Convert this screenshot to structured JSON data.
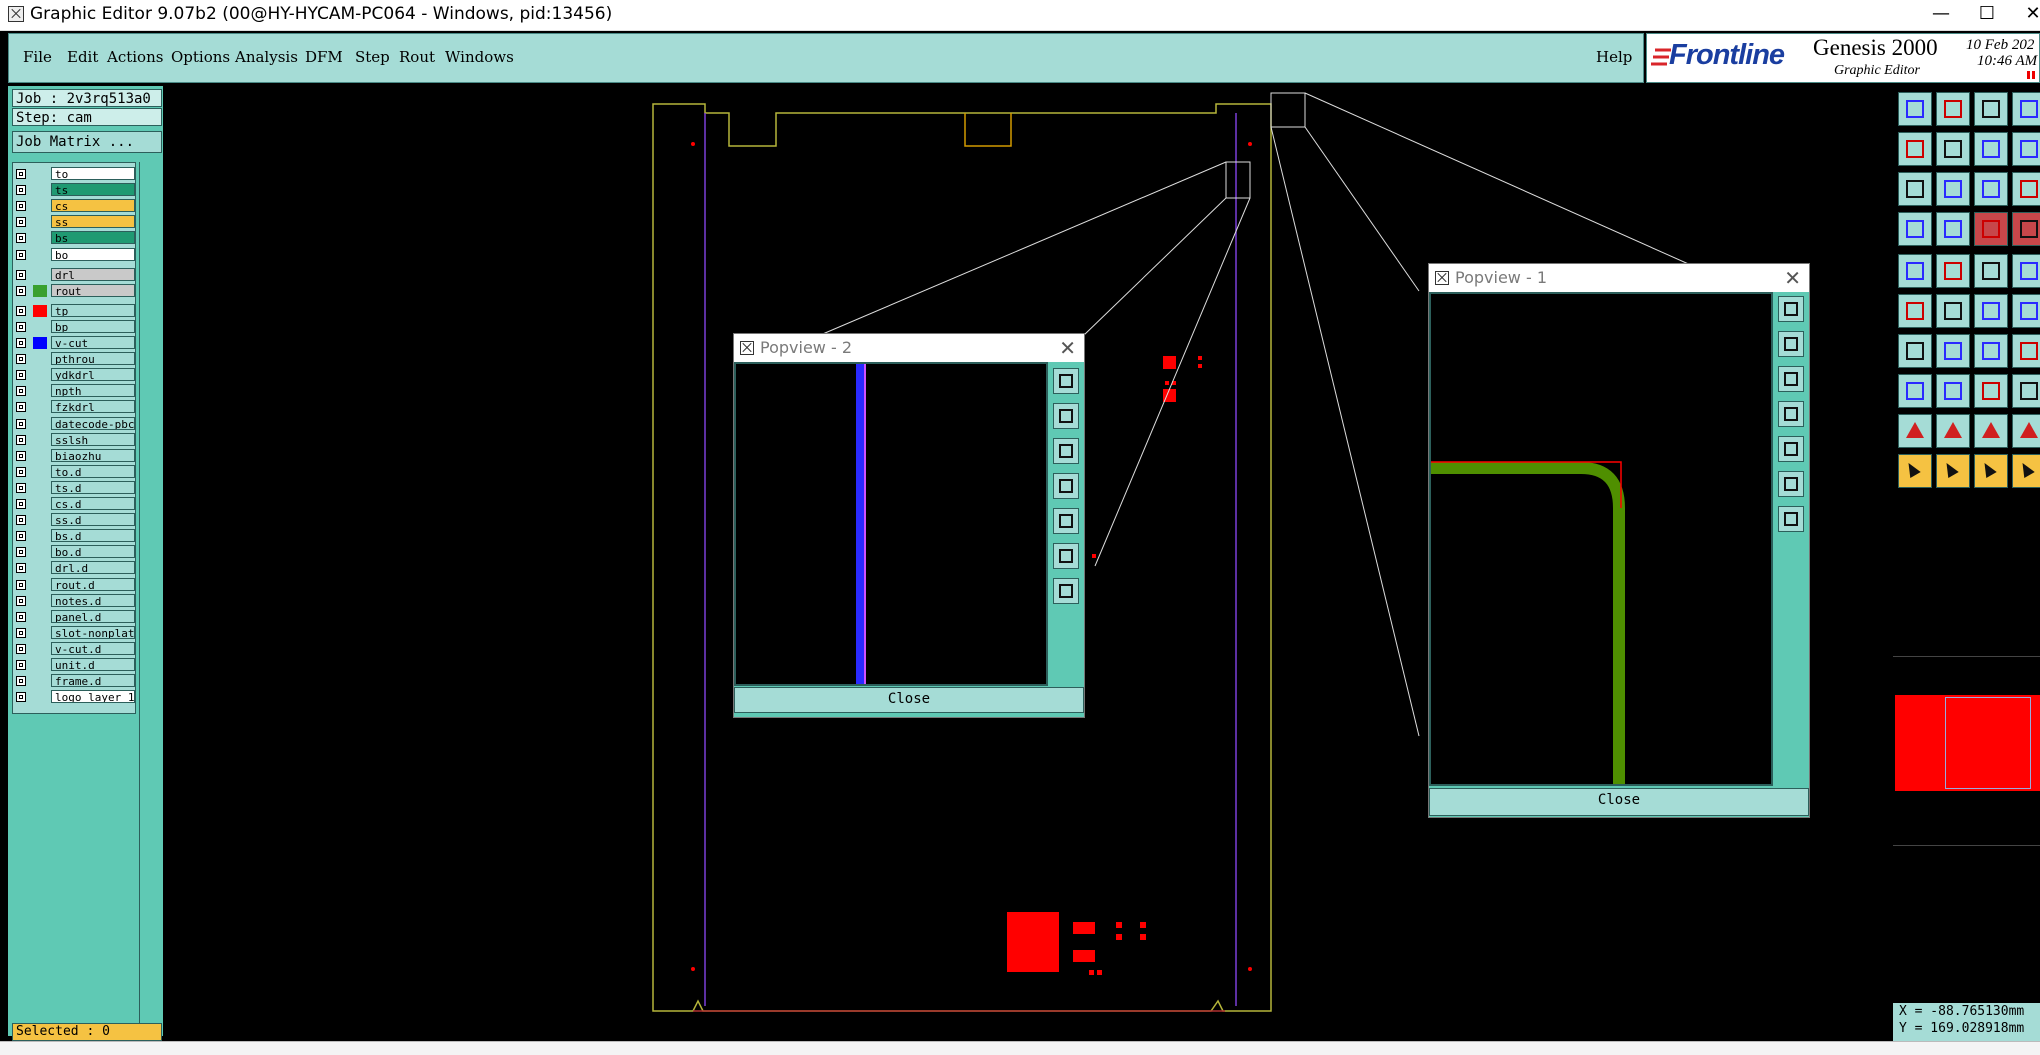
{
  "window": {
    "title": "Graphic Editor 9.07b2 (00@HY-HYCAM-PC064 - Windows, pid:13456)",
    "minimize": "—",
    "maximize": "☐",
    "close": "✕"
  },
  "menu": [
    {
      "label": "File"
    },
    {
      "label": "Edit"
    },
    {
      "label": "Actions"
    },
    {
      "label": "Options"
    },
    {
      "label": "Analysis"
    },
    {
      "label": "DFM"
    },
    {
      "label": "Step"
    },
    {
      "label": "Rout"
    },
    {
      "label": "Windows"
    }
  ],
  "help_label": "Help",
  "brand": {
    "logo": "Frontline",
    "product": "Genesis 2000",
    "subtitle": "Graphic Editor",
    "date": "10 Feb 202",
    "time": "10:46 AM"
  },
  "job": {
    "job_text": "Job : 2v3rq513a0",
    "step_text": "Step: cam",
    "matrix_button": "Job Matrix ..."
  },
  "layers": [
    {
      "name": "to",
      "bg": "#ffffff",
      "swatch": ""
    },
    {
      "name": "ts",
      "bg": "#1f9a72",
      "swatch": ""
    },
    {
      "name": "cs",
      "bg": "#f5c242",
      "swatch": ""
    },
    {
      "name": "ss",
      "bg": "#f5c242",
      "swatch": ""
    },
    {
      "name": "bs",
      "bg": "#1f9a72",
      "swatch": ""
    },
    {
      "name": "bo",
      "bg": "#ffffff",
      "swatch": ""
    },
    {
      "name": "drl",
      "bg": "#c9c9c9",
      "swatch": ""
    },
    {
      "name": "rout",
      "bg": "#c9c9c9",
      "swatch": "#3aa02e"
    },
    {
      "name": "tp",
      "bg": "#a5dcd6",
      "swatch": "#ff0000"
    },
    {
      "name": "bp",
      "bg": "#a5dcd6",
      "swatch": ""
    },
    {
      "name": "v-cut",
      "bg": "#a5dcd6",
      "swatch": "#0000ff"
    },
    {
      "name": "pthrou",
      "bg": "#a5dcd6",
      "swatch": ""
    },
    {
      "name": "ydkdrl",
      "bg": "#a5dcd6",
      "swatch": ""
    },
    {
      "name": "npth",
      "bg": "#a5dcd6",
      "swatch": ""
    },
    {
      "name": "fzkdrl",
      "bg": "#a5dcd6",
      "swatch": ""
    },
    {
      "name": "datecode-pbc",
      "bg": "#a5dcd6",
      "swatch": ""
    },
    {
      "name": "sslsh",
      "bg": "#a5dcd6",
      "swatch": ""
    },
    {
      "name": "biaozhu",
      "bg": "#a5dcd6",
      "swatch": ""
    },
    {
      "name": "to.d",
      "bg": "#a5dcd6",
      "swatch": ""
    },
    {
      "name": "ts.d",
      "bg": "#a5dcd6",
      "swatch": ""
    },
    {
      "name": "cs.d",
      "bg": "#a5dcd6",
      "swatch": ""
    },
    {
      "name": "ss.d",
      "bg": "#a5dcd6",
      "swatch": ""
    },
    {
      "name": "bs.d",
      "bg": "#a5dcd6",
      "swatch": ""
    },
    {
      "name": "bo.d",
      "bg": "#a5dcd6",
      "swatch": ""
    },
    {
      "name": "drl.d",
      "bg": "#a5dcd6",
      "swatch": ""
    },
    {
      "name": "rout.d",
      "bg": "#a5dcd6",
      "swatch": ""
    },
    {
      "name": "notes.d",
      "bg": "#a5dcd6",
      "swatch": ""
    },
    {
      "name": "panel.d",
      "bg": "#a5dcd6",
      "swatch": ""
    },
    {
      "name": "slot-nonplat",
      "bg": "#a5dcd6",
      "swatch": ""
    },
    {
      "name": "v-cut.d",
      "bg": "#a5dcd6",
      "swatch": ""
    },
    {
      "name": "unit.d",
      "bg": "#a5dcd6",
      "swatch": ""
    },
    {
      "name": "frame.d",
      "bg": "#a5dcd6",
      "swatch": ""
    },
    {
      "name": "logo_layer_1",
      "bg": "#ffffff",
      "swatch": ""
    }
  ],
  "selected_text": "Selected : 0",
  "popview2": {
    "title": "Popview - 2",
    "close_button": "Close",
    "close_x": "✕"
  },
  "popview1": {
    "title": "Popview - 1",
    "close_button": "Close",
    "close_x": "✕"
  },
  "coords": {
    "x": "X = -88.765130mm",
    "y": "Y = 169.028918mm"
  },
  "colors": {
    "panel_teal": "#5fc9b4",
    "light_teal": "#a5dcd6",
    "outline_yellow": "#b5b53a",
    "rout_green": "#4f8f00",
    "vcut_blue": "#2a2aff",
    "pad_red": "#ff0000"
  }
}
